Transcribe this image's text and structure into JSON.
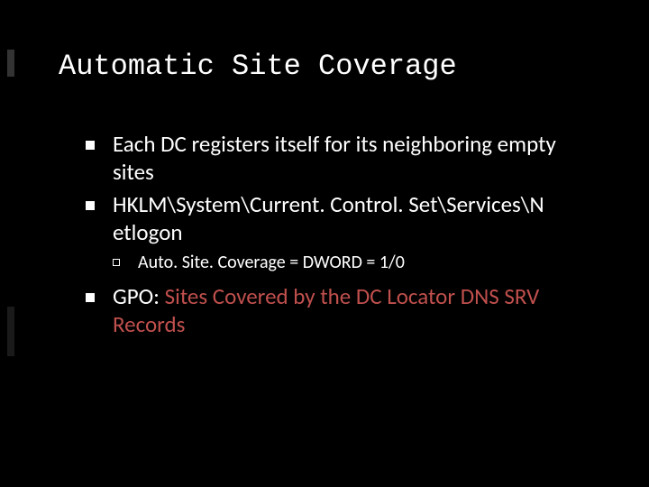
{
  "slide": {
    "title": "Automatic Site Coverage",
    "bullets": {
      "b1": "Each DC registers itself for its neighboring empty sites",
      "b2": "HKLM\\System\\Current. Control. Set\\Services\\N etlogon",
      "b2_sub": "Auto. Site. Coverage = DWORD = 1/0",
      "b3_prefix": "GPO: ",
      "b3_highlight": "Sites Covered by the DC Locator DNS SRV Records"
    }
  }
}
